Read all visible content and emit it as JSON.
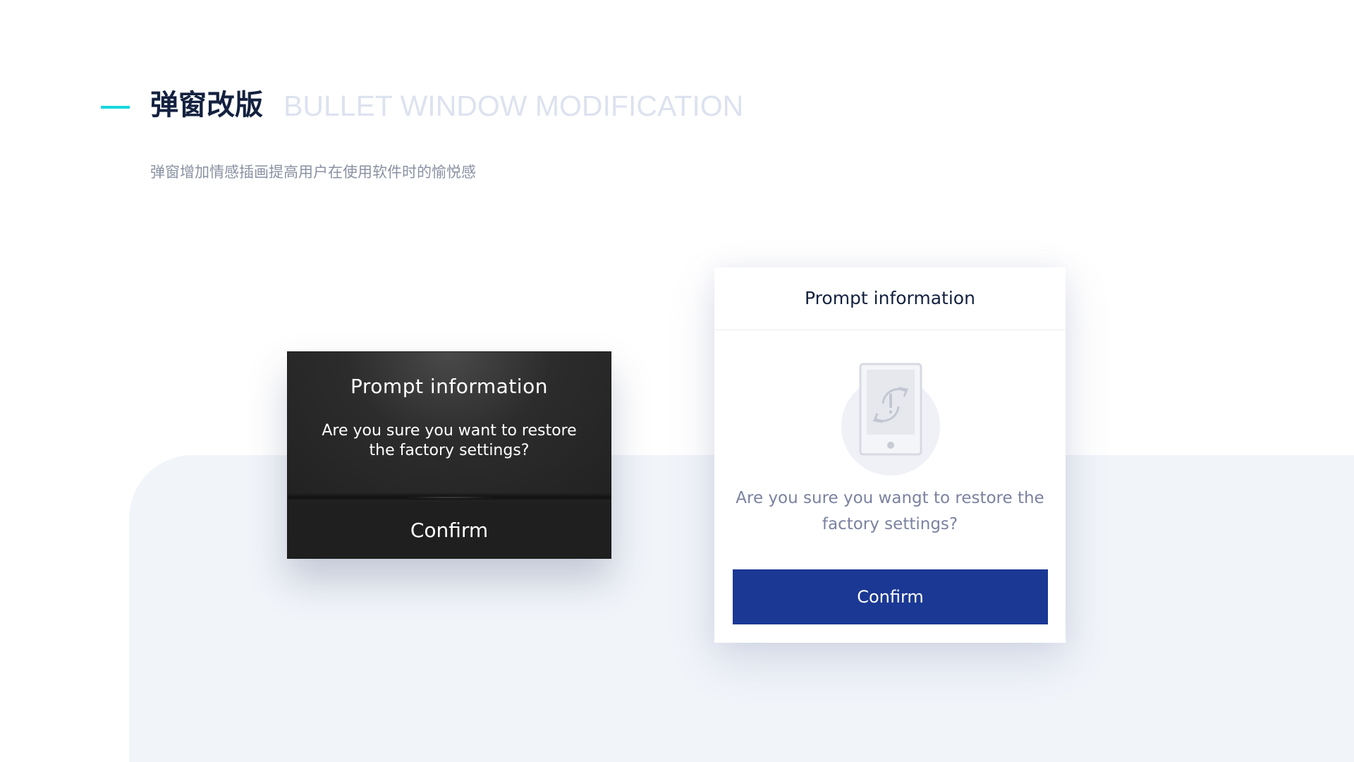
{
  "header": {
    "title_cn": "弹窗改版",
    "title_en": "BULLET WINDOW MODIFICATION",
    "subtitle": "弹窗增加情感插画提高用户在使用软件时的愉悦感"
  },
  "old_dialog": {
    "title": "Prompt information",
    "message": "Are you sure you want to restore the factory settings?",
    "confirm_label": "Confirm"
  },
  "new_dialog": {
    "title": "Prompt information",
    "message": "Are you sure you wangt to restore the factory settings?",
    "confirm_label": "Confirm",
    "illustration_icon": "phone-restore-icon"
  },
  "colors": {
    "accent": "#15d7e0",
    "title": "#14213f",
    "title_en": "#dde2ef",
    "subtitle": "#8a91a2",
    "background_panel": "#f1f4f9",
    "old_dialog_bg": "#1f1f1f",
    "new_confirm_bg": "#1a3894",
    "new_message": "#7b82a0"
  }
}
